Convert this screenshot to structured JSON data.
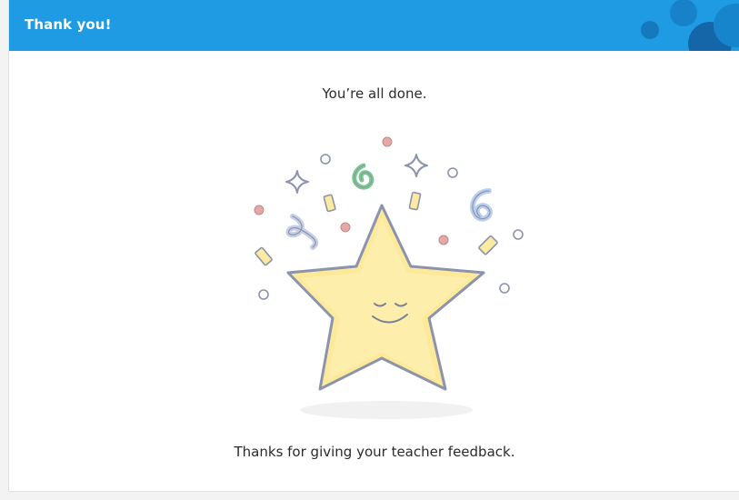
{
  "header": {
    "title": "Thank you!",
    "background_color": "#1e9be3"
  },
  "main": {
    "done_message": "You’re all done.",
    "thanks_message": "Thanks for giving your teacher feedback.",
    "illustration_icon": "smiling-star-confetti-icon"
  },
  "colors": {
    "star_fill": "#fde99a",
    "star_stroke": "#8b93ad",
    "confetti_blue": "#7e95d1",
    "confetti_green": "#79c98f",
    "confetti_pink": "#e6a7a7",
    "confetti_yellow": "#fbeaa2"
  }
}
